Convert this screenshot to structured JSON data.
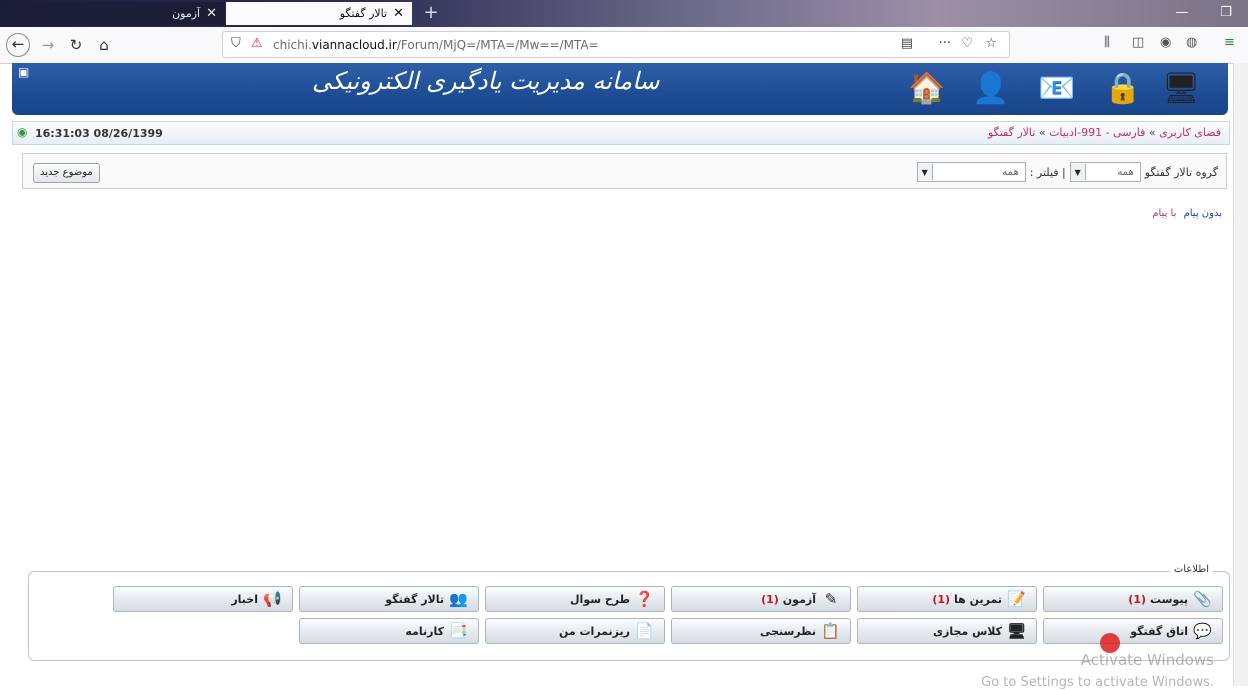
{
  "browser": {
    "tabs": [
      {
        "title": "آزمون",
        "active": false
      },
      {
        "title": "تالار گفتگو",
        "active": true
      }
    ],
    "url_prefix": "chichi.",
    "url_domain": "viannacloud.ir",
    "url_path": "/Forum/MjQ=/MTA=/Mw==/MTA="
  },
  "banner": {
    "title": "سامانه مدیریت یادگیری الکترونیکی"
  },
  "status": {
    "clock": "16:31:03 08/26/1399",
    "breadcrumb": [
      "فضای کاربری",
      "فارسی - 991-ادبیات",
      "تالار گفتگو"
    ],
    "breadcrumb_sep": "»"
  },
  "filters": {
    "new_topic": "موضوع جدید",
    "group_label": "گروه تالار گفتگو",
    "group_value": "همه",
    "filter_label": "| فیلتر :",
    "filter_value": "همه"
  },
  "message_links": {
    "without": "بدون پیام",
    "with": "با پیام"
  },
  "info": {
    "title": "اطلاعات",
    "buttons": [
      {
        "label": "پیوست",
        "count": "(1)",
        "icon": "paperclip-icon"
      },
      {
        "label": "تمرین ها",
        "count": "(1)",
        "icon": "notepad-icon"
      },
      {
        "label": "آزمون",
        "count": "(1)",
        "icon": "pencil-icon"
      },
      {
        "label": "طرح سوال",
        "count": "",
        "icon": "question-icon"
      },
      {
        "label": "تالار گفتگو",
        "count": "",
        "icon": "people-icon"
      },
      {
        "label": "اخبار",
        "count": "",
        "icon": "megaphone-icon"
      },
      {
        "label": "اتاق گفتگو",
        "count": "",
        "icon": "chat-icon"
      },
      {
        "label": "کلاس مجازی",
        "count": "",
        "icon": "monitor-icon"
      },
      {
        "label": "نظرسنجی",
        "count": "",
        "icon": "survey-icon"
      },
      {
        "label": "ریزنمرات من",
        "count": "",
        "icon": "grades-icon"
      },
      {
        "label": "کارنامه",
        "count": "",
        "icon": "report-icon"
      }
    ]
  },
  "watermark": {
    "line1": "Activate Windows",
    "line2": "Go to Settings to activate Windows."
  }
}
